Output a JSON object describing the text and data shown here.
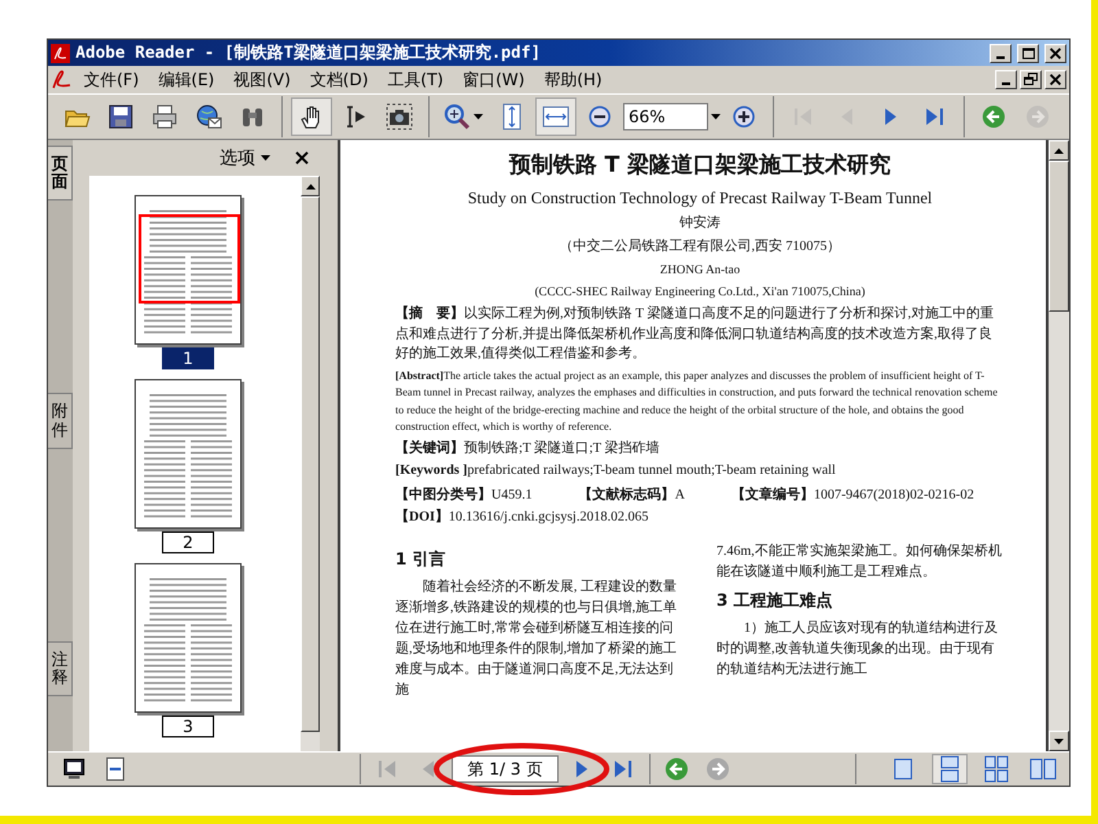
{
  "window": {
    "title": "Adobe Reader - [制铁路T梁隧道口架梁施工技术研究.pdf]"
  },
  "menu": [
    "文件(F)",
    "编辑(E)",
    "视图(V)",
    "文档(D)",
    "工具(T)",
    "窗口(W)",
    "帮助(H)"
  ],
  "toolbar": [
    [
      {
        "kind": "open",
        "pressed": false,
        "disabled": false
      },
      {
        "kind": "save",
        "pressed": false,
        "disabled": false
      },
      {
        "kind": "print",
        "pressed": false,
        "disabled": false
      },
      {
        "kind": "email",
        "pressed": false,
        "disabled": false
      },
      {
        "kind": "find",
        "pressed": false,
        "disabled": false
      }
    ],
    [
      {
        "kind": "hand",
        "pressed": true,
        "disabled": false
      },
      {
        "kind": "select",
        "pressed": false,
        "disabled": false
      },
      {
        "kind": "snapshot",
        "pressed": false,
        "disabled": false
      }
    ],
    [
      {
        "kind": "zoomin",
        "pressed": false,
        "disabled": false,
        "dropdown": true
      },
      {
        "kind": "fitpage",
        "pressed": false,
        "disabled": false
      },
      {
        "kind": "fitwidth",
        "pressed": true,
        "disabled": false
      },
      {
        "kind": "zoomout",
        "pressed": false,
        "disabled": false
      },
      {
        "kind": "zoomfield",
        "value": "66%"
      },
      {
        "kind": "zoomplus",
        "pressed": false,
        "disabled": false
      }
    ],
    [
      {
        "kind": "first",
        "pressed": false,
        "disabled": true
      },
      {
        "kind": "prev",
        "pressed": false,
        "disabled": true
      },
      {
        "kind": "next",
        "pressed": false,
        "disabled": false
      },
      {
        "kind": "last",
        "pressed": false,
        "disabled": false
      }
    ],
    [
      {
        "kind": "back",
        "pressed": false,
        "disabled": false
      },
      {
        "kind": "forward",
        "pressed": false,
        "disabled": true
      }
    ]
  ],
  "nav_tabs": [
    {
      "label": "页面",
      "selected": true
    },
    {
      "label": "附件",
      "selected": false
    },
    {
      "label": "注释",
      "selected": false
    }
  ],
  "panel": {
    "options": "选项"
  },
  "thumbnails": [
    {
      "label": "1",
      "selected": true
    },
    {
      "label": "2",
      "selected": false
    },
    {
      "label": "3",
      "selected": false
    }
  ],
  "document": {
    "title": "预制铁路 T 梁隧道口架梁施工技术研究",
    "title_en": "Study on  Construction Technology  of  Precast Railway T-Beam Tunnel",
    "author": "钟安涛",
    "affiliation": "（中交二公局铁路工程有限公司,西安 710075）",
    "author_en": "ZHONG An-tao",
    "affiliation_en": "(CCCC-SHEC Railway Engineering Co.Ltd., Xi'an 710075,China)",
    "fields": [
      "**【摘　要】**以实际工程为例,对预制铁路 T 梁隧道口高度不足的问题进行了分析和探讨,对施工中的重点和难点进行了分析,并提出降低架桥机作业高度和降低洞口轨道结构高度的技术改造方案,取得了良好的施工效果,值得类似工程借鉴和参考。",
      "**[Abstract]**The article takes the actual project as an example, this paper analyzes and discusses the problem of insufficient height of T-Beam tunnel in Precast railway, analyzes the emphases and difficulties in construction, and puts forward the technical renovation scheme to reduce the height of the bridge-erecting machine and reduce the height of the orbital structure of the hole, and obtains the good construction effect, which is worthy of reference.",
      "**【关键词】**预制铁路;T 梁隧道口;T 梁挡砟墙",
      "**[Keywords ]**prefabricated railways;T-beam tunnel mouth;T-beam retaining wall"
    ],
    "classification": [
      "**【中图分类号】**U459.1",
      "**【文献标志码】**A",
      "**【文章编号】**1007-9467(2018)02-0216-02"
    ],
    "doi": "**【DOI】**10.13616/j.cnki.gcjsysj.2018.02.065",
    "columns": [
      [
        {
          "kind": "heading",
          "text": "1  引言"
        },
        {
          "kind": "paragraph",
          "text": "随着社会经济的不断发展, 工程建设的数量逐渐增多,铁路建设的规模的也与日俱增,施工单位在进行施工时,常常会碰到桥隧互相连接的问题,受场地和地理条件的限制,增加了桥梁的施工难度与成本。由于隧道洞口高度不足,无法达到施"
        }
      ],
      [
        {
          "kind": "continuation",
          "text": "7.46m,不能正常实施架梁施工。如何确保架桥机能在该隧道中顺利施工是工程难点。"
        },
        {
          "kind": "heading",
          "text": "3  工程施工难点"
        },
        {
          "kind": "paragraph",
          "text": "1）施工人员应该对现有的轨道结构进行及时的调整,改善轨道失衡现象的出现。由于现有的轨道结构无法进行施工"
        }
      ]
    ]
  },
  "status_bar": {
    "left": [
      {
        "kind": "monitor"
      },
      {
        "kind": "pagebox"
      }
    ],
    "nav": [
      {
        "kind": "first",
        "disabled": true
      },
      {
        "kind": "prev",
        "disabled": true
      },
      {
        "kind": "pagefield",
        "value": "第 1/ 3 页"
      },
      {
        "kind": "next",
        "disabled": false
      },
      {
        "kind": "last",
        "disabled": false
      }
    ],
    "history": [
      {
        "kind": "back",
        "disabled": false
      },
      {
        "kind": "forward",
        "disabled": true
      }
    ],
    "layouts": [
      {
        "kind": "single",
        "selected": false
      },
      {
        "kind": "continuous",
        "selected": true
      },
      {
        "kind": "grid",
        "selected": false
      },
      {
        "kind": "facing",
        "selected": false
      }
    ]
  }
}
